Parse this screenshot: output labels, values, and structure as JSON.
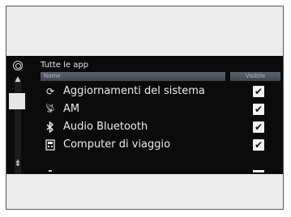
{
  "screen": {
    "title": "Tutte le app",
    "columns": {
      "name": "Nome",
      "visible": "Visibile"
    },
    "items": [
      {
        "label": "Aggiornamenti del sistema",
        "icon": "refresh-icon",
        "checked": true
      },
      {
        "label": "AM",
        "icon": "radio-antenna-icon",
        "checked": true
      },
      {
        "label": "Audio Bluetooth",
        "icon": "bluetooth-icon",
        "checked": true
      },
      {
        "label": "Computer di viaggio",
        "icon": "trip-computer-icon",
        "checked": true
      }
    ]
  }
}
